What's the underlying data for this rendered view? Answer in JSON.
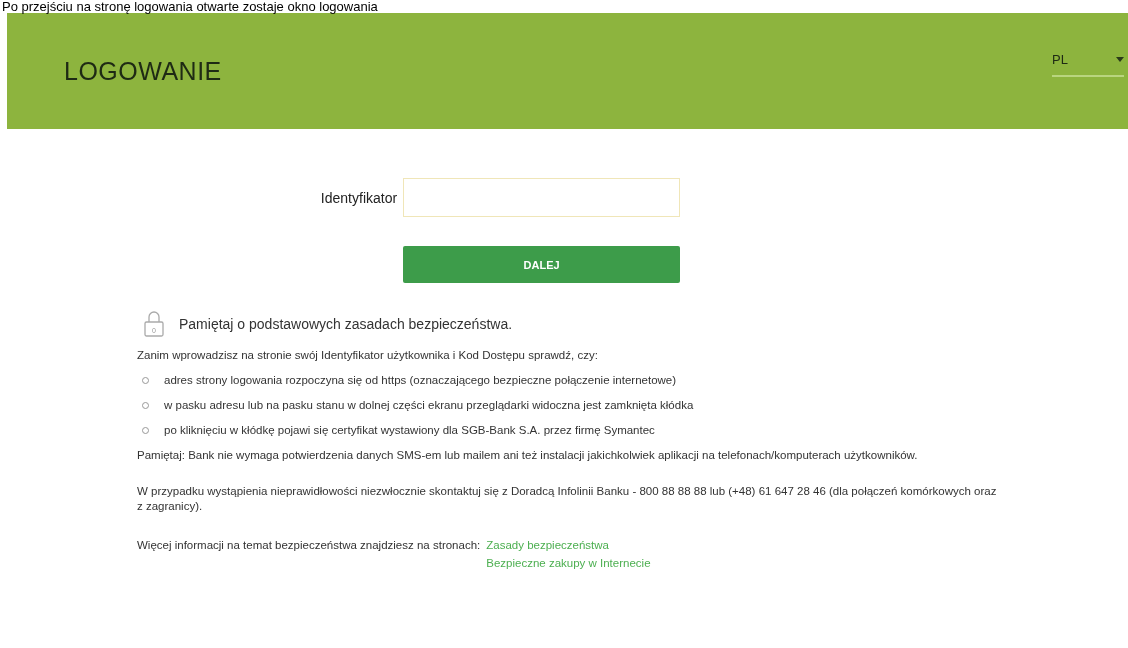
{
  "caption": "Po przejściu na stronę logowania otwarte zostaje okno logowania",
  "header": {
    "title": "LOGOWANIE",
    "language": "PL"
  },
  "login": {
    "label": "Identyfikator",
    "button": "DALEJ"
  },
  "security": {
    "heading": "Pamiętaj o podstawowych zasadach bezpieczeństwa.",
    "lock_digit": "0",
    "intro": "Zanim wprowadzisz na stronie swój Identyfikator użytkownika i Kod Dostępu sprawdź, czy:",
    "bullets": [
      "adres strony logowania rozpoczyna się od https (oznaczającego bezpieczne połączenie internetowe)",
      "w pasku adresu lub na pasku stanu w dolnej części ekranu przeglądarki widoczna jest zamknięta kłódka",
      "po kliknięciu w kłódkę pojawi się certyfikat wystawiony dla SGB-Bank S.A. przez firmę Symantec"
    ],
    "note": "Pamiętaj: Bank nie wymaga potwierdzenia danych SMS-em lub mailem ani też instalacji jakichkolwiek aplikacji na telefonach/komputerach użytkowników.",
    "contact": "W przypadku wystąpienia nieprawidłowości niezwłocznie skontaktuj się z Doradcą Infolinii Banku - 800 88 88 88 lub (+48) 61 647 28 46 (dla połączeń komórkowych oraz z zagranicy).",
    "more": "Więcej informacji na temat bezpieczeństwa znajdziesz na stronach:",
    "links": [
      "Zasady bezpieczeństwa",
      "Bezpieczne zakupy w Internecie"
    ]
  }
}
